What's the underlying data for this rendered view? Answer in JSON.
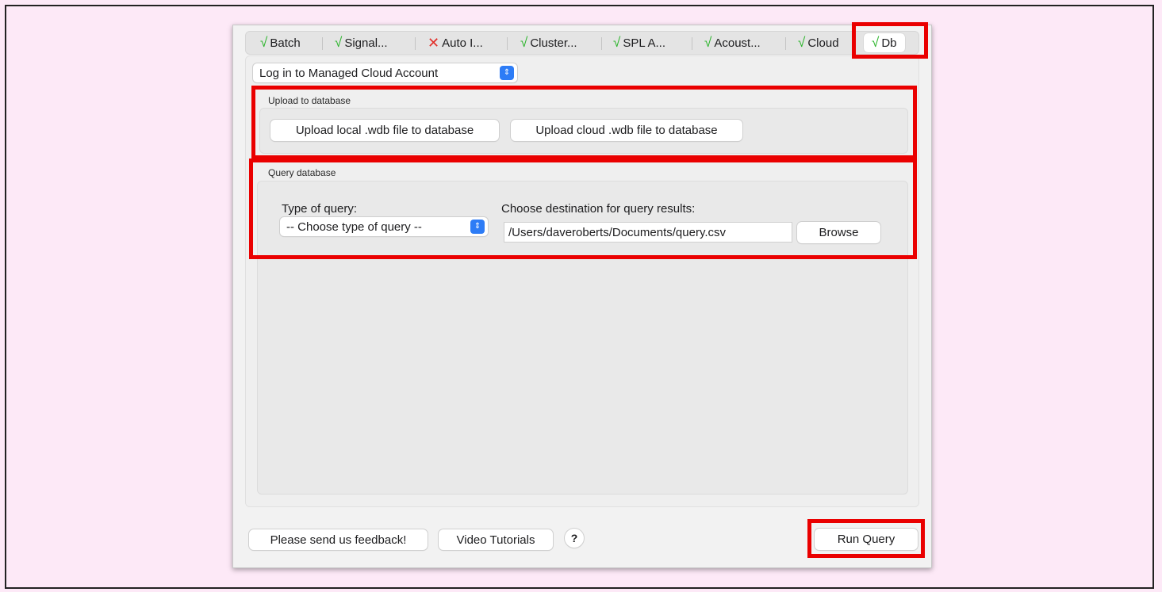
{
  "tabs": [
    {
      "status": "ok",
      "label": "Batch"
    },
    {
      "status": "ok",
      "label": "Signal..."
    },
    {
      "status": "error",
      "label": "Auto I..."
    },
    {
      "status": "ok",
      "label": "Cluster..."
    },
    {
      "status": "ok",
      "label": "SPL A..."
    },
    {
      "status": "ok",
      "label": "Acoust..."
    },
    {
      "status": "ok",
      "label": "Cloud"
    },
    {
      "status": "ok",
      "label": "Db"
    }
  ],
  "status_glyphs": {
    "ok": "√",
    "error": "✕"
  },
  "account_select": {
    "value": "Log in to Managed Cloud Account"
  },
  "upload_group": {
    "title": "Upload to database",
    "local_button": "Upload local .wdb file to database",
    "cloud_button": "Upload cloud .wdb file to database"
  },
  "query_group": {
    "title": "Query database",
    "type_label": "Type of query:",
    "type_select": "-- Choose type of query --",
    "dest_label": "Choose destination for query results:",
    "dest_value": "/Users/daveroberts/Documents/query.csv",
    "browse_button": "Browse"
  },
  "footer": {
    "feedback_button": "Please send us feedback!",
    "tutorials_button": "Video Tutorials",
    "help_button": "?",
    "run_button": "Run Query"
  },
  "colors": {
    "highlight": "#ea0000",
    "ok": "#2db52d",
    "error": "#e2302a",
    "accent": "#2d7cf6",
    "background": "#fde9f7"
  }
}
